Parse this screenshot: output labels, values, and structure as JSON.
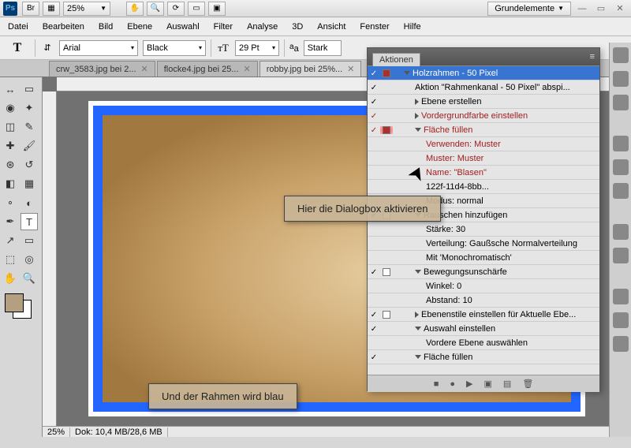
{
  "titlebar": {
    "app_abbr": "Ps",
    "bridge_abbr": "Br",
    "zoom": "25%",
    "workspace": "Grundelemente"
  },
  "menu": [
    "Datei",
    "Bearbeiten",
    "Bild",
    "Ebene",
    "Auswahl",
    "Filter",
    "Analyse",
    "3D",
    "Ansicht",
    "Fenster",
    "Hilfe"
  ],
  "optbar": {
    "tool": "T",
    "font": "Arial",
    "style": "Black",
    "size": "29 Pt",
    "aa_label": "Stark"
  },
  "tabs": [
    {
      "label": "crw_3583.jpg bei 2...",
      "active": false
    },
    {
      "label": "flocke4.jpg bei 25...",
      "active": false
    },
    {
      "label": "robby.jpg bei 25%...",
      "active": true
    }
  ],
  "callouts": {
    "dialog": "Hier die Dialogbox aktivieren",
    "blue": "Und der Rahmen wird blau"
  },
  "status": {
    "zoom": "25%",
    "doc": "Dok: 10,4 MB/28,6 MB"
  },
  "actions": {
    "title": "Aktionen",
    "rows": [
      {
        "chk": true,
        "dlg": "on",
        "indent": 1,
        "tri": "open",
        "label": "Holzrahmen - 50 Pixel",
        "hl": true
      },
      {
        "chk": true,
        "dlg": "",
        "indent": 2,
        "tri": "",
        "label": "Aktion \"Rahmenkanal - 50 Pixel\" abspi..."
      },
      {
        "chk": true,
        "dlg": "",
        "indent": 2,
        "tri": "right",
        "label": "Ebene erstellen"
      },
      {
        "chk": true,
        "dlg": "",
        "indent": 2,
        "tri": "right",
        "label": "Vordergrundfarbe einstellen",
        "red": true
      },
      {
        "chk": true,
        "dlg": "redglow",
        "indent": 2,
        "tri": "open",
        "label": "Fläche füllen",
        "red": true
      },
      {
        "chk": false,
        "dlg": "",
        "indent": 3,
        "tri": "",
        "label": "Verwenden: Muster",
        "red": true
      },
      {
        "chk": false,
        "dlg": "",
        "indent": 3,
        "tri": "",
        "label": "Muster: Muster",
        "red": true
      },
      {
        "chk": false,
        "dlg": "",
        "indent": 3,
        "tri": "",
        "label": "Name: \"Blasen\"",
        "red": true
      },
      {
        "chk": false,
        "dlg": "",
        "indent": 3,
        "tri": "",
        "label": "122f-11d4-8bb..."
      },
      {
        "chk": false,
        "dlg": "",
        "indent": 3,
        "tri": "",
        "label": "Modus: normal"
      },
      {
        "chk": true,
        "dlg": "box",
        "indent": 2,
        "tri": "open",
        "label": "Rauschen hinzufügen"
      },
      {
        "chk": false,
        "dlg": "",
        "indent": 3,
        "tri": "",
        "label": "Stärke: 30"
      },
      {
        "chk": false,
        "dlg": "",
        "indent": 3,
        "tri": "",
        "label": "Verteilung: Gaußsche Normalverteilung"
      },
      {
        "chk": false,
        "dlg": "",
        "indent": 3,
        "tri": "",
        "label": "Mit 'Monochromatisch'"
      },
      {
        "chk": true,
        "dlg": "box",
        "indent": 2,
        "tri": "open",
        "label": "Bewegungsunschärfe"
      },
      {
        "chk": false,
        "dlg": "",
        "indent": 3,
        "tri": "",
        "label": "Winkel: 0"
      },
      {
        "chk": false,
        "dlg": "",
        "indent": 3,
        "tri": "",
        "label": "Abstand: 10"
      },
      {
        "chk": true,
        "dlg": "box",
        "indent": 2,
        "tri": "right",
        "label": "Ebenenstile einstellen für Aktuelle Ebe..."
      },
      {
        "chk": true,
        "dlg": "",
        "indent": 2,
        "tri": "open",
        "label": "Auswahl einstellen"
      },
      {
        "chk": false,
        "dlg": "",
        "indent": 3,
        "tri": "",
        "label": "Vordere Ebene auswählen"
      },
      {
        "chk": true,
        "dlg": "",
        "indent": 2,
        "tri": "open",
        "label": "Fläche füllen"
      }
    ]
  }
}
